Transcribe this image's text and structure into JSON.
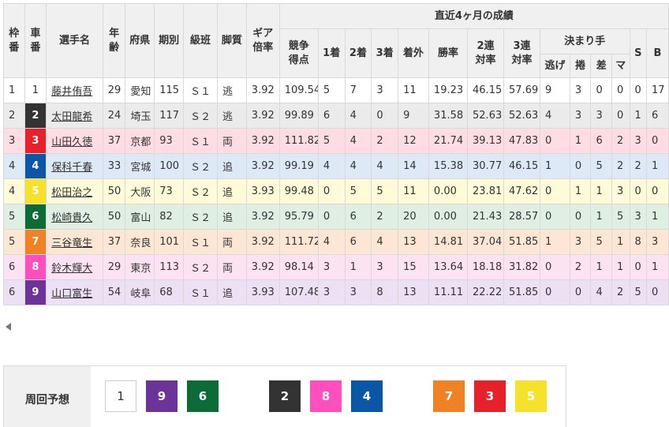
{
  "headers": {
    "waku": "枠番",
    "sha": "車番",
    "name": "選手名",
    "age": "年齢",
    "pref": "府県",
    "ki": "期別",
    "class": "級班",
    "style": "脚質",
    "gear": "ギア倍率",
    "recent": "直近4ヶ月の成績",
    "score": "競争得点",
    "first": "1着",
    "second": "2着",
    "third": "3着",
    "out": "着外",
    "win_rate": "勝率",
    "rate2": "2連対率",
    "rate3": "3連対率",
    "kimarite": "決まり手",
    "nige": "逃げ",
    "makuri": "捲",
    "sashi": "差",
    "mark": "マ",
    "s": "S",
    "b": "B"
  },
  "rows": [
    {
      "waku": "1",
      "num": "1",
      "name": "藤井侑吾",
      "age": "29",
      "pref": "愛知",
      "ki": "115",
      "class": "Ｓ１",
      "style": "逃",
      "gear": "3.92",
      "score": "109.54",
      "first": "5",
      "second": "7",
      "third": "3",
      "out": "11",
      "win_rate": "19.23",
      "rate2": "46.15",
      "rate3": "57.69",
      "nige": "9",
      "makuri": "3",
      "sashi": "0",
      "mark": "0",
      "s": "0",
      "b": "17",
      "num_bg": "#ffffff",
      "num_fg": "#333333",
      "row_bg": "#ffffff"
    },
    {
      "waku": "2",
      "num": "2",
      "name": "太田龍希",
      "age": "24",
      "pref": "埼玉",
      "ki": "117",
      "class": "Ｓ２",
      "style": "逃",
      "gear": "3.92",
      "score": "99.89",
      "first": "6",
      "second": "4",
      "third": "0",
      "out": "9",
      "win_rate": "31.58",
      "rate2": "52.63",
      "rate3": "52.63",
      "nige": "4",
      "makuri": "3",
      "sashi": "3",
      "mark": "0",
      "s": "1",
      "b": "6",
      "num_bg": "#333333",
      "num_fg": "#ffffff",
      "row_bg": "#ebebeb"
    },
    {
      "waku": "3",
      "num": "3",
      "name": "山田久徳",
      "age": "37",
      "pref": "京都",
      "ki": "93",
      "class": "Ｓ１",
      "style": "両",
      "gear": "3.92",
      "score": "111.82",
      "first": "5",
      "second": "4",
      "third": "2",
      "out": "12",
      "win_rate": "21.74",
      "rate2": "39.13",
      "rate3": "47.83",
      "nige": "0",
      "makuri": "1",
      "sashi": "6",
      "mark": "2",
      "s": "3",
      "b": "0",
      "num_bg": "#e8202a",
      "num_fg": "#ffffff",
      "row_bg": "#ffdde3"
    },
    {
      "waku": "4",
      "num": "4",
      "name": "保科千春",
      "age": "33",
      "pref": "宮城",
      "ki": "100",
      "class": "Ｓ２",
      "style": "追",
      "gear": "3.92",
      "score": "99.19",
      "first": "4",
      "second": "4",
      "third": "4",
      "out": "14",
      "win_rate": "15.38",
      "rate2": "30.77",
      "rate3": "46.15",
      "nige": "1",
      "makuri": "0",
      "sashi": "5",
      "mark": "2",
      "s": "2",
      "b": "1",
      "num_bg": "#0a57a8",
      "num_fg": "#ffffff",
      "row_bg": "#dde9f6"
    },
    {
      "waku": "4",
      "num": "5",
      "name": "松田治之",
      "age": "50",
      "pref": "大阪",
      "ki": "73",
      "class": "Ｓ２",
      "style": "追",
      "gear": "3.93",
      "score": "99.48",
      "first": "0",
      "second": "5",
      "third": "5",
      "out": "11",
      "win_rate": "0.00",
      "rate2": "23.81",
      "rate3": "47.62",
      "nige": "0",
      "makuri": "1",
      "sashi": "1",
      "mark": "3",
      "s": "0",
      "b": "0",
      "num_bg": "#f7e12a",
      "num_fg": "#ffffff",
      "row_bg": "#fffbd9"
    },
    {
      "waku": "5",
      "num": "6",
      "name": "松崎貴久",
      "age": "50",
      "pref": "富山",
      "ki": "82",
      "class": "Ｓ２",
      "style": "追",
      "gear": "3.92",
      "score": "95.79",
      "first": "0",
      "second": "6",
      "third": "2",
      "out": "20",
      "win_rate": "0.00",
      "rate2": "21.43",
      "rate3": "28.57",
      "nige": "0",
      "makuri": "0",
      "sashi": "1",
      "mark": "5",
      "s": "3",
      "b": "1",
      "num_bg": "#0d6b37",
      "num_fg": "#ffffff",
      "row_bg": "#dff0e2"
    },
    {
      "waku": "5",
      "num": "7",
      "name": "三谷竜生",
      "age": "37",
      "pref": "奈良",
      "ki": "101",
      "class": "Ｓ１",
      "style": "両",
      "gear": "3.92",
      "score": "111.72",
      "first": "4",
      "second": "6",
      "third": "4",
      "out": "13",
      "win_rate": "14.81",
      "rate2": "37.04",
      "rate3": "51.85",
      "nige": "1",
      "makuri": "3",
      "sashi": "5",
      "mark": "1",
      "s": "8",
      "b": "3",
      "num_bg": "#f08225",
      "num_fg": "#ffffff",
      "row_bg": "#fde7d4"
    },
    {
      "waku": "6",
      "num": "8",
      "name": "鈴木輝大",
      "age": "29",
      "pref": "東京",
      "ki": "113",
      "class": "Ｓ２",
      "style": "両",
      "gear": "3.92",
      "score": "98.14",
      "first": "3",
      "second": "1",
      "third": "3",
      "out": "15",
      "win_rate": "13.64",
      "rate2": "18.18",
      "rate3": "31.82",
      "nige": "0",
      "makuri": "2",
      "sashi": "1",
      "mark": "1",
      "s": "0",
      "b": "1",
      "num_bg": "#ff4fbf",
      "num_fg": "#ffffff",
      "row_bg": "#fde2f3"
    },
    {
      "waku": "6",
      "num": "9",
      "name": "山口富生",
      "age": "54",
      "pref": "岐阜",
      "ki": "68",
      "class": "Ｓ１",
      "style": "追",
      "gear": "3.93",
      "score": "107.48",
      "first": "3",
      "second": "3",
      "third": "8",
      "out": "13",
      "win_rate": "11.11",
      "rate2": "22.22",
      "rate3": "51.85",
      "nige": "0",
      "makuri": "0",
      "sashi": "4",
      "mark": "2",
      "s": "5",
      "b": "0",
      "num_bg": "#6c3398",
      "num_fg": "#ffffff",
      "row_bg": "#ece1f4"
    }
  ],
  "yoso": {
    "label": "周回予想",
    "items": [
      {
        "num": "1",
        "bg": "#ffffff",
        "fg": "#333333"
      },
      {
        "num": "9",
        "bg": "#6c3398",
        "fg": "#ffffff"
      },
      {
        "num": "6",
        "bg": "#0d6b37",
        "fg": "#ffffff"
      },
      {
        "num": "2",
        "bg": "#333333",
        "fg": "#ffffff"
      },
      {
        "num": "8",
        "bg": "#ff4fbf",
        "fg": "#ffffff"
      },
      {
        "num": "4",
        "bg": "#0a57a8",
        "fg": "#ffffff"
      },
      {
        "num": "7",
        "bg": "#f08225",
        "fg": "#ffffff"
      },
      {
        "num": "3",
        "bg": "#e8202a",
        "fg": "#ffffff"
      },
      {
        "num": "5",
        "bg": "#f7e12a",
        "fg": "#ffffff"
      }
    ]
  }
}
